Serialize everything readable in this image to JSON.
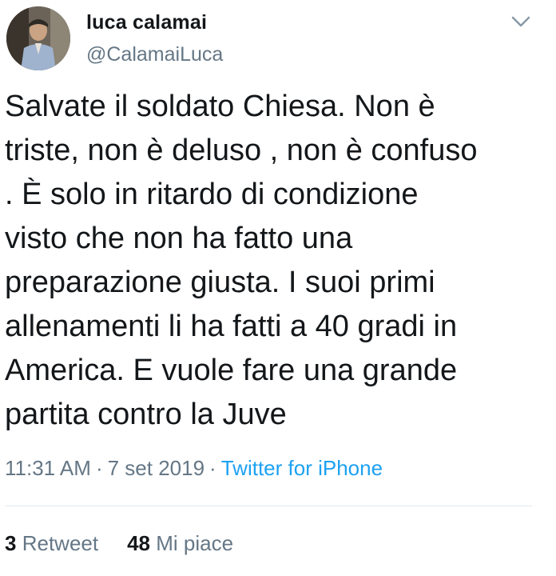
{
  "user": {
    "display_name": "luca calamai",
    "handle": "@CalamaiLuca"
  },
  "tweet": {
    "text": "Salvate il soldato Chiesa. Non è\ntriste, non è deluso , non è confuso\n. È solo in ritardo di condizione\nvisto che non ha fatto una\npreparazione giusta. I suoi primi\nallenamenti li ha fatti a 40 gradi in\nAmerica. E vuole fare una grande\npartita contro la Juve",
    "time": "11:31 AM",
    "date": "7 set 2019",
    "separator": "·",
    "source": "Twitter for iPhone"
  },
  "stats": {
    "retweets_count": "3",
    "retweets_label": "Retweet",
    "likes_count": "48",
    "likes_label": "Mi piace"
  },
  "icons": {
    "menu": "chevron-down-icon"
  },
  "colors": {
    "link": "#1da1f2",
    "secondary_text": "#657786",
    "primary_text": "#14171a",
    "divider": "#e1e8ed"
  }
}
